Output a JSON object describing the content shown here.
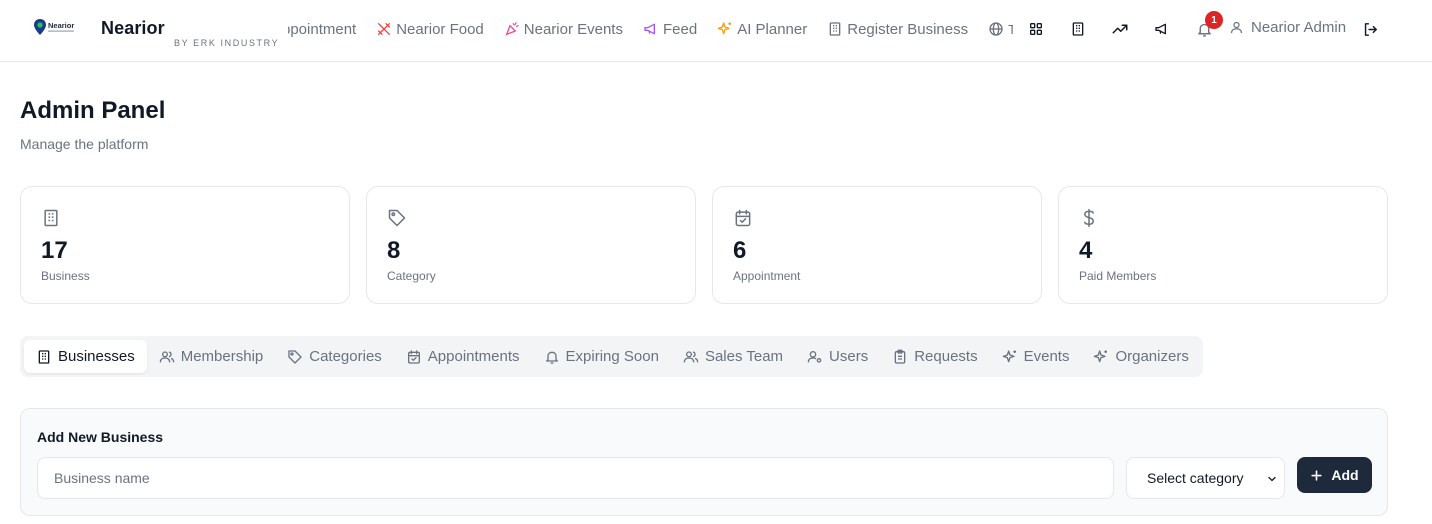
{
  "header": {
    "brand": "Nearior",
    "brand_sub": "BY ERK INDUSTRY",
    "logo_text": "Nearior",
    "nav_links": [
      {
        "label": "ppointment",
        "icon": "calendar-icon"
      },
      {
        "label": "Nearior Food",
        "icon": "utensils-icon",
        "color": "#ef4444"
      },
      {
        "label": "Nearior Events",
        "icon": "party-icon",
        "color": "#ec4899"
      },
      {
        "label": "Feed",
        "icon": "megaphone-icon",
        "color": "#a855f7"
      },
      {
        "label": "AI Planner",
        "icon": "sparkles-icon",
        "color": "#f59e0b"
      },
      {
        "label": "Register Business",
        "icon": "building-icon"
      },
      {
        "label": "TR",
        "icon": "globe-icon"
      }
    ],
    "notification_count": "1",
    "user_name": "Nearior Admin"
  },
  "page": {
    "title": "Admin Panel",
    "subtitle": "Manage the platform"
  },
  "stats": [
    {
      "value": "17",
      "label": "Business",
      "icon": "building-icon"
    },
    {
      "value": "8",
      "label": "Category",
      "icon": "tag-icon"
    },
    {
      "value": "6",
      "label": "Appointment",
      "icon": "calendar-check-icon"
    },
    {
      "value": "4",
      "label": "Paid Members",
      "icon": "dollar-icon"
    }
  ],
  "tabs": [
    {
      "label": "Businesses",
      "icon": "building-icon",
      "active": true
    },
    {
      "label": "Membership",
      "icon": "users-icon"
    },
    {
      "label": "Categories",
      "icon": "tag-icon"
    },
    {
      "label": "Appointments",
      "icon": "calendar-check-icon"
    },
    {
      "label": "Expiring Soon",
      "icon": "bell-icon"
    },
    {
      "label": "Sales Team",
      "icon": "users-icon"
    },
    {
      "label": "Users",
      "icon": "user-cog-icon"
    },
    {
      "label": "Requests",
      "icon": "clipboard-icon"
    },
    {
      "label": "Events",
      "icon": "sparkles-icon"
    },
    {
      "label": "Organizers",
      "icon": "sparkles-icon"
    }
  ],
  "add_form": {
    "title": "Add New Business",
    "name_placeholder": "Business name",
    "name_value": "",
    "category_selected": "Select category",
    "add_label": "Add"
  },
  "colors": {
    "primary_button": "#1e293b",
    "badge": "#dc2626",
    "muted_text": "#6b7280"
  }
}
